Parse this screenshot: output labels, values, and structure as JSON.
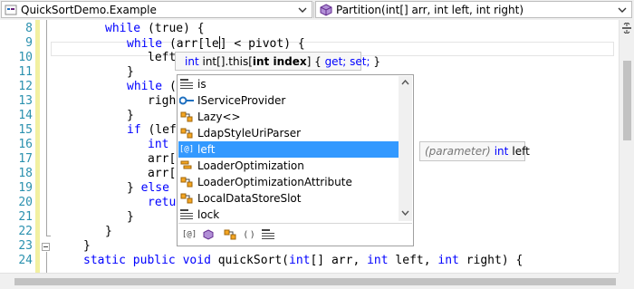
{
  "navbar": {
    "project": "QuickSortDemo.Example",
    "member": "Partition(int[] arr, int left, int right)"
  },
  "editor": {
    "line_numbers": [
      "8",
      "9",
      "10",
      "11",
      "12",
      "13",
      "14",
      "15",
      "16",
      "17",
      "18",
      "19",
      "20",
      "21",
      "22",
      "23",
      "24"
    ],
    "lines": {
      "l8": {
        "kw": "while",
        "rest": " (true) {"
      },
      "l9": {
        "kw": "while",
        "before_caret": " (arr[le",
        "after_caret": "] < pivot) {"
      },
      "l10": "left",
      "l11": "}",
      "l12": {
        "kw": "while",
        "rest": " (a"
      },
      "l13": "right",
      "l14": "}",
      "l15": {
        "kw": "if",
        "rest": " (left"
      },
      "l16": {
        "kw": "int",
        "rest": " t"
      },
      "l17": "arr[r",
      "l18": "arr[l",
      "l19": {
        "rest": "} ",
        "kw": "else",
        "rest2": " {"
      },
      "l20": {
        "kw": "retur",
        "rest": ""
      },
      "l21": "}",
      "l22": "}",
      "l23": "}",
      "l24": {
        "k1": "static",
        "k2": "public",
        "k3": "void",
        "name": " quickSort(",
        "k4": "int",
        "a": "[] arr, ",
        "k5": "int",
        "b": " left, ",
        "k6": "int",
        "c": " right) {"
      }
    }
  },
  "signature_tooltip": {
    "type": "int",
    "target": "int[].this[",
    "param": "int index",
    "accessors_open": "] {",
    "get": "get;",
    "set": "set;",
    "close": "}"
  },
  "completion": {
    "items": [
      {
        "label": "is",
        "icon": "keyword-icon"
      },
      {
        "label": "IServiceProvider",
        "icon": "interface-icon"
      },
      {
        "label": "Lazy<>",
        "icon": "class-icon"
      },
      {
        "label": "LdapStyleUriParser",
        "icon": "class-icon"
      },
      {
        "label": "left",
        "icon": "parameter-icon",
        "selected": true
      },
      {
        "label": "LoaderOptimization",
        "icon": "enum-icon"
      },
      {
        "label": "LoaderOptimizationAttribute",
        "icon": "class-icon"
      },
      {
        "label": "LocalDataStoreSlot",
        "icon": "class-icon"
      },
      {
        "label": "lock",
        "icon": "keyword-icon"
      }
    ],
    "filters": [
      "local-filter-icon",
      "namespace-filter-icon",
      "class-filter-icon",
      "snippet-filter-icon",
      "keyword-filter-icon"
    ],
    "filter_text": {
      "local": "[@]",
      "snippet": "( )"
    }
  },
  "quick_info": {
    "kind": "(parameter)",
    "type": "int",
    "name": "left"
  },
  "colors": {
    "keyword": "#0000ff",
    "line_number": "#2b91af",
    "selection": "#3399ff",
    "change_bar": "#f2f0a1",
    "class_icon": "#c27d0e",
    "interface_icon": "#1e6fbf"
  }
}
